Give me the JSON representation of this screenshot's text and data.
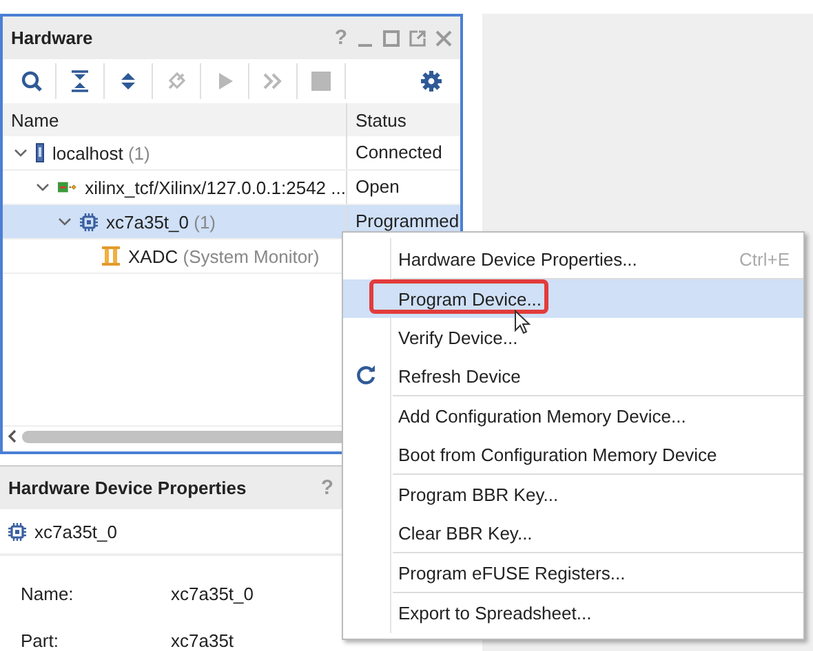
{
  "hardware_panel": {
    "title": "Hardware",
    "help": "?",
    "toolbar": [
      {
        "kind": "search",
        "disabled": false
      },
      {
        "kind": "collapse",
        "disabled": false
      },
      {
        "kind": "expand",
        "disabled": false
      },
      {
        "kind": "connect",
        "disabled": true
      },
      {
        "kind": "run",
        "disabled": true
      },
      {
        "kind": "skip",
        "disabled": true
      },
      {
        "kind": "stop",
        "disabled": true
      },
      {
        "kind": "settings",
        "disabled": false
      }
    ],
    "columns": [
      "Name",
      "Status"
    ],
    "tree": [
      {
        "kind": "host",
        "name": "localhost",
        "count": "(1)",
        "status": "Connected",
        "selected": false,
        "expanded": true,
        "children": [
          {
            "kind": "target",
            "name": "xilinx_tcf/Xilinx/127.0.0.1:2542 ...",
            "status": "Open",
            "selected": false,
            "expanded": true,
            "children": [
              {
                "kind": "device",
                "name": "xc7a35t_0",
                "count": "(1)",
                "status": "Programmed",
                "selected": true,
                "expanded": true,
                "children": [
                  {
                    "kind": "monitor",
                    "name": "XADC",
                    "count": "(System Monitor)",
                    "selected": false
                  }
                ]
              }
            ]
          }
        ]
      }
    ]
  },
  "properties_panel": {
    "title": "Hardware Device Properties",
    "help": "?",
    "device": "xc7a35t_0",
    "fields": [
      {
        "label": "Name:",
        "value": "xc7a35t_0"
      },
      {
        "label": "Part:",
        "value": "xc7a35t"
      }
    ]
  },
  "context_menu": {
    "groups": [
      [
        {
          "label": "Hardware Device Properties...",
          "shortcut": "Ctrl+E",
          "kind": "plain",
          "selected": false,
          "highlighted": false
        }
      ],
      [
        {
          "label": "Program Device...",
          "kind": "plain",
          "selected": true,
          "highlighted": true
        },
        {
          "label": "Verify Device...",
          "kind": "plain",
          "selected": false,
          "highlighted": false
        },
        {
          "label": "Refresh Device",
          "kind": "refresh",
          "selected": false,
          "highlighted": false
        }
      ],
      [
        {
          "label": "Add Configuration Memory Device...",
          "kind": "plain",
          "selected": false,
          "highlighted": false
        },
        {
          "label": "Boot from Configuration Memory Device",
          "kind": "plain",
          "selected": false,
          "highlighted": false
        }
      ],
      [
        {
          "label": "Program BBR Key...",
          "kind": "plain",
          "selected": false,
          "highlighted": false
        },
        {
          "label": "Clear BBR Key...",
          "kind": "plain",
          "selected": false,
          "highlighted": false
        }
      ],
      [
        {
          "label": "Program eFUSE Registers...",
          "kind": "plain",
          "selected": false,
          "highlighted": false
        }
      ],
      [
        {
          "label": "Export to Spreadsheet...",
          "kind": "plain",
          "selected": false,
          "highlighted": false
        }
      ]
    ]
  }
}
